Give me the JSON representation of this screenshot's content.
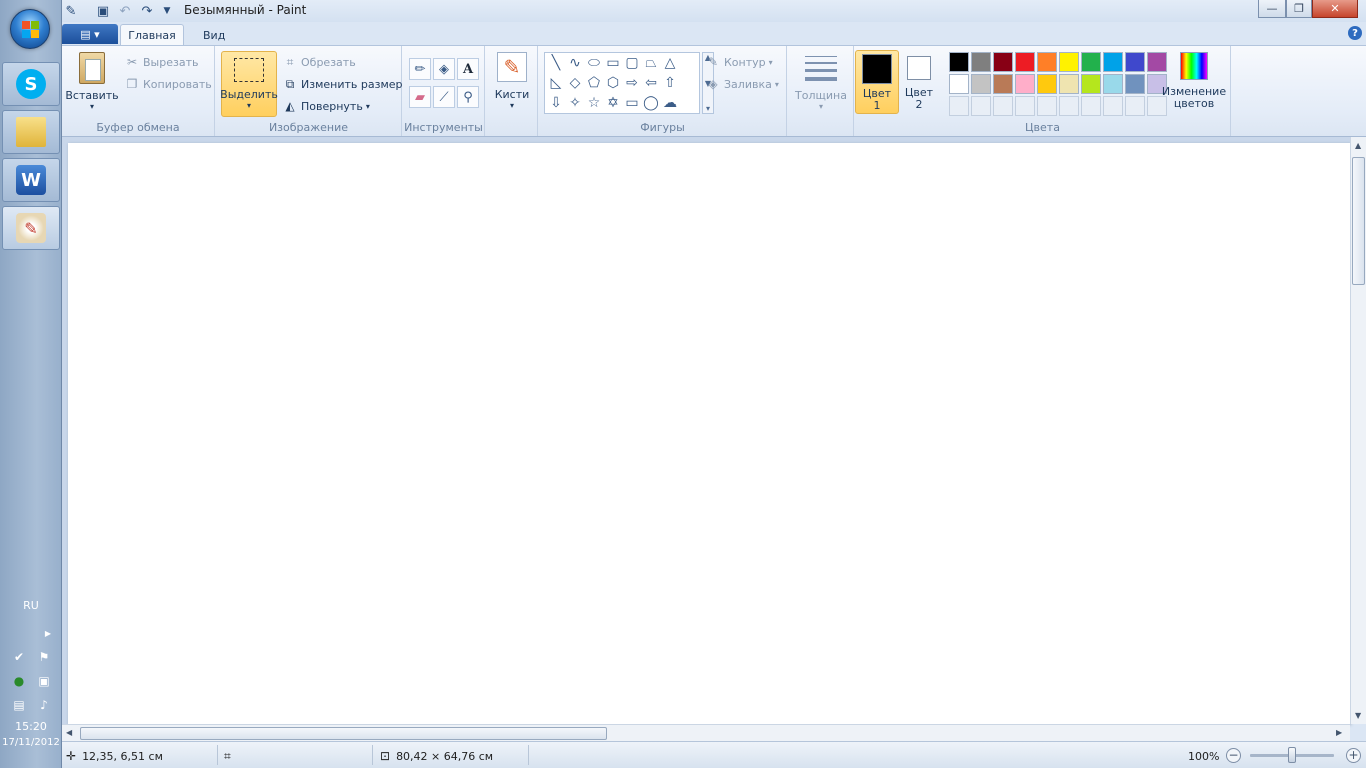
{
  "window": {
    "title": "Безымянный - Paint"
  },
  "tabs": [
    {
      "label": "Главная"
    },
    {
      "label": "Вид"
    }
  ],
  "ribbon": {
    "clipboard": {
      "group_label": "Буфер обмена",
      "paste_label": "Вставить",
      "cut_label": "Вырезать",
      "copy_label": "Копировать"
    },
    "image": {
      "group_label": "Изображение",
      "select_label": "Выделить",
      "crop_label": "Обрезать",
      "resize_label": "Изменить размер",
      "rotate_label": "Повернуть"
    },
    "tools": {
      "group_label": "Инструменты",
      "brushes_label": "Кисти"
    },
    "shapes": {
      "group_label": "Фигуры",
      "outline_label": "Контур",
      "fill_label": "Заливка"
    },
    "size": {
      "label": "Толщина"
    },
    "colors": {
      "group_label": "Цвета",
      "color1_label_line1": "Цвет",
      "color1_label_line2": "1",
      "color2_label_line1": "Цвет",
      "color2_label_line2": "2",
      "color1_value": "#000000",
      "color2_value": "#ffffff",
      "edit_colors_line1": "Изменение",
      "edit_colors_line2": "цветов",
      "palette_row1": [
        "#000000",
        "#7f7f7f",
        "#880015",
        "#ed1c24",
        "#ff7f27",
        "#fff200",
        "#22b14c",
        "#00a2e8",
        "#3f48cc",
        "#a349a4"
      ],
      "palette_row2": [
        "#ffffff",
        "#c3c3c3",
        "#b97a57",
        "#ffaec9",
        "#ffc90e",
        "#efe4b0",
        "#b5e61d",
        "#99d9ea",
        "#7092be",
        "#c8bfe7"
      ]
    }
  },
  "status": {
    "cursor_position": "12,35, 6,51 см",
    "canvas_size": "80,42 × 64,76 см",
    "zoom": "100%"
  },
  "taskbar": {
    "language": "RU",
    "time": "15:20",
    "date": "17/11/2012"
  }
}
